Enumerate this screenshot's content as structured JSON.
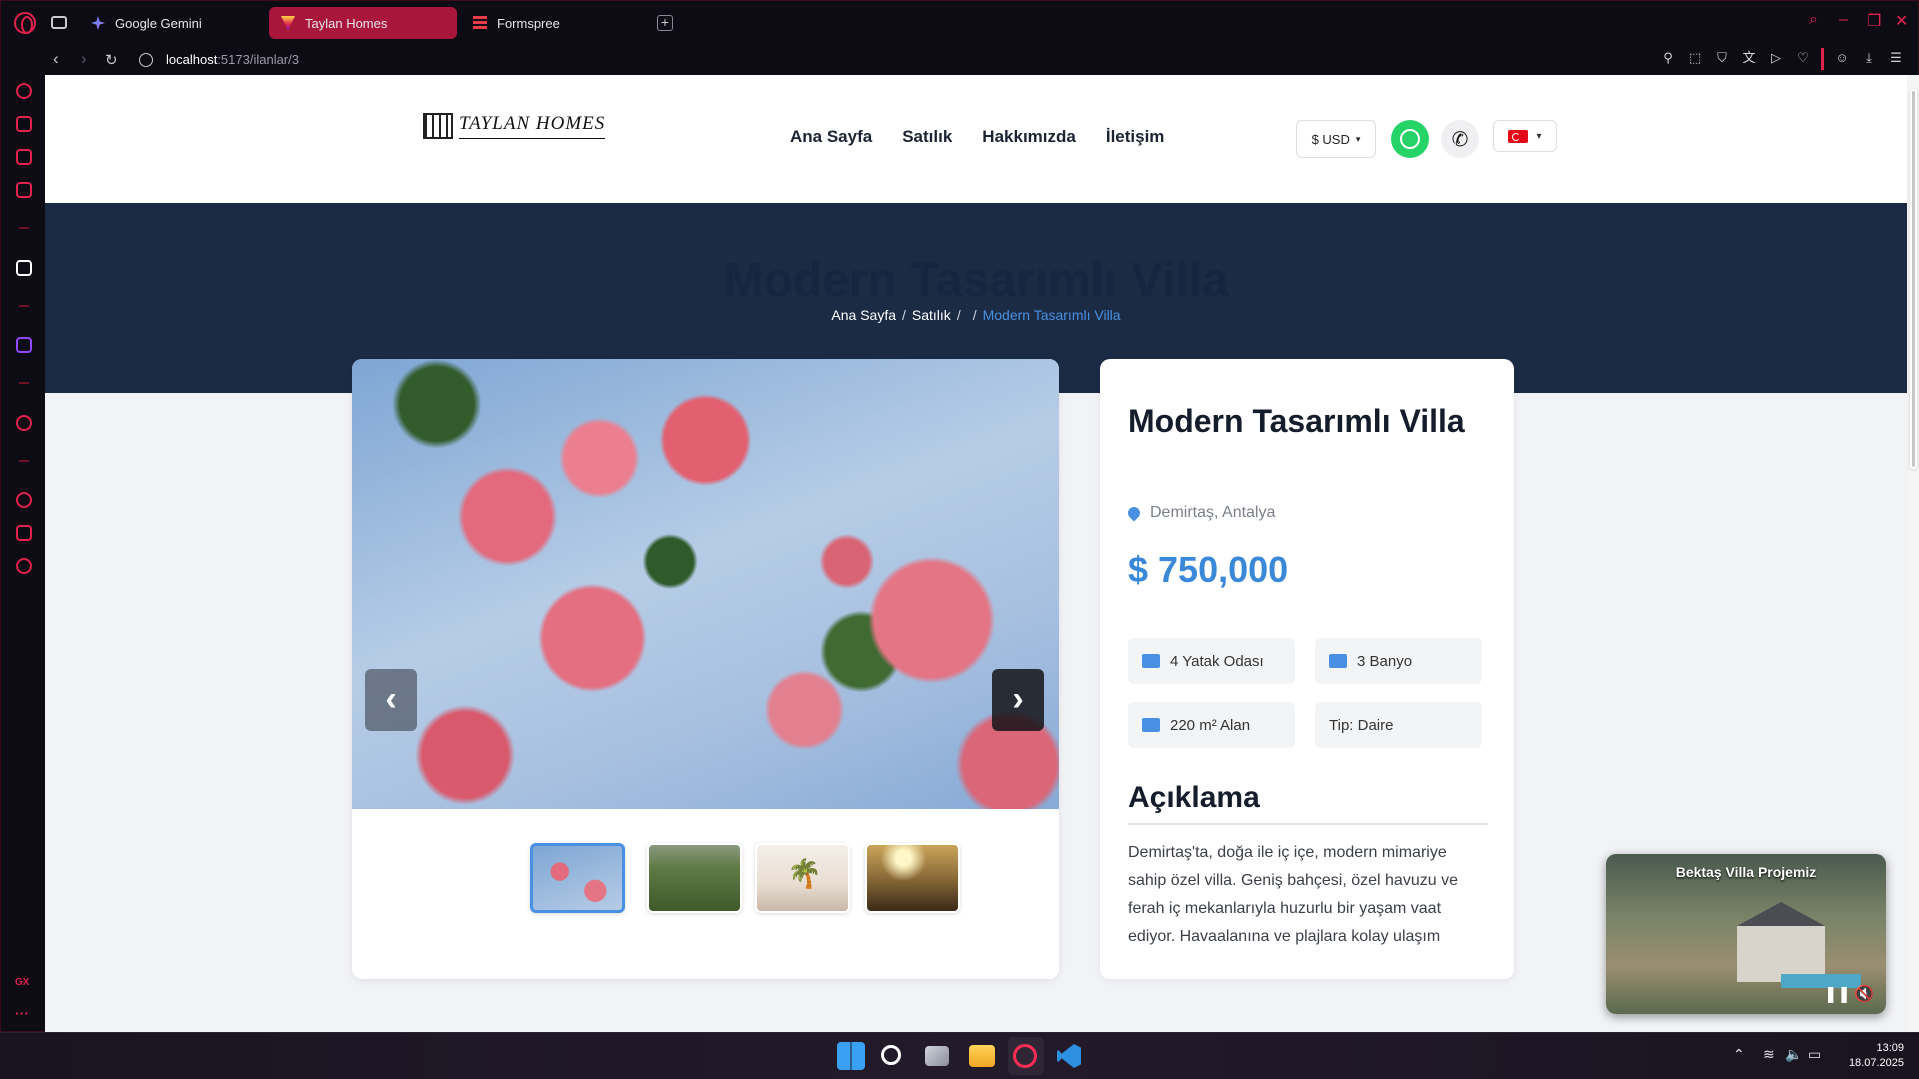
{
  "browser": {
    "tabs": [
      {
        "label": "Google Gemini"
      },
      {
        "label": "Taylan Homes"
      },
      {
        "label": "Formspree"
      }
    ],
    "url_host": "localhost",
    "url_path": ":5173/ilanlar/3"
  },
  "site": {
    "logo_text": "TAYLAN HOMES",
    "nav": [
      "Ana Sayfa",
      "Satılık",
      "Hakkımızda",
      "İletişim"
    ],
    "currency": "$ USD"
  },
  "hero": {
    "title": "Modern Tasarımlı Villa",
    "crumb_home": "Ana Sayfa",
    "crumb_sale": "Satılık",
    "crumb_current": "Modern Tasarımlı Villa"
  },
  "listing": {
    "title": "Modern Tasarımlı Villa",
    "location": "Demirtaş, Antalya",
    "price": "$ 750,000",
    "features": [
      "4 Yatak Odası",
      "3 Banyo",
      "220 m² Alan",
      "Tip: Daire"
    ],
    "desc_heading": "Açıklama",
    "description": "Demirtaş'ta, doğa ile iç içe, modern mimariye sahip özel villa. Geniş bahçesi, özel havuzu ve ferah iç mekanlarıyla huzurlu bir yaşam vaat ediyor. Havaalanına ve plajlara kolay ulaşım"
  },
  "video": {
    "title": "Bektaş Villa Projemiz"
  },
  "taskbar": {
    "time": "13:09",
    "date": "18.07.2025"
  }
}
